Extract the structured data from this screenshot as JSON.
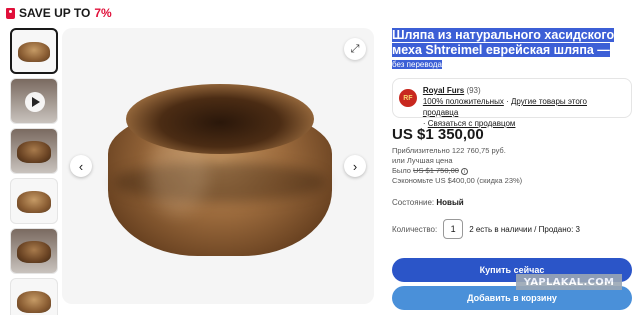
{
  "promo": {
    "text": "SAVE UP TO",
    "percent": "7%",
    "color": "#e0103a"
  },
  "gallery": {
    "thumbnails": [
      {
        "name": "thumb-hat-front",
        "active": true
      },
      {
        "name": "thumb-video",
        "video": true
      },
      {
        "name": "thumb-hat-on-stand"
      },
      {
        "name": "thumb-hat-top"
      },
      {
        "name": "thumb-hat-on-stand-2"
      },
      {
        "name": "thumb-hat-partial"
      }
    ],
    "prev_icon": "‹",
    "next_icon": "›",
    "expand_icon": "⤢"
  },
  "listing": {
    "title": "Шляпа из натурального хасидского меха Shtreimel еврейская шляпа —",
    "subtitle": "без перевода"
  },
  "seller": {
    "logo_text": "RF",
    "name": "Royal Furs",
    "count": "(93)",
    "positive": "100% положительных",
    "other_items": "Другие товары этого продавца",
    "contact": "Связаться с продавцом"
  },
  "pricing": {
    "price": "US $1 350,00",
    "approx": "Приблизительно 122 760,75 руб.",
    "best_offer": "или Лучшая цена",
    "was_label": "Было",
    "was_price": "US $1 750,00",
    "saved": "Сэкономьте US $400,00 (скидка 23%)"
  },
  "condition": {
    "label": "Состояние:",
    "value": "Новый"
  },
  "quantity": {
    "label": "Количество:",
    "value": "1",
    "availability": "2 есть в наличии / Продано: 3"
  },
  "actions": {
    "buy_now": "Купить сейчас",
    "add_to_cart": "Добавить в корзину"
  },
  "watermark": "YAPLAKAL.COM"
}
